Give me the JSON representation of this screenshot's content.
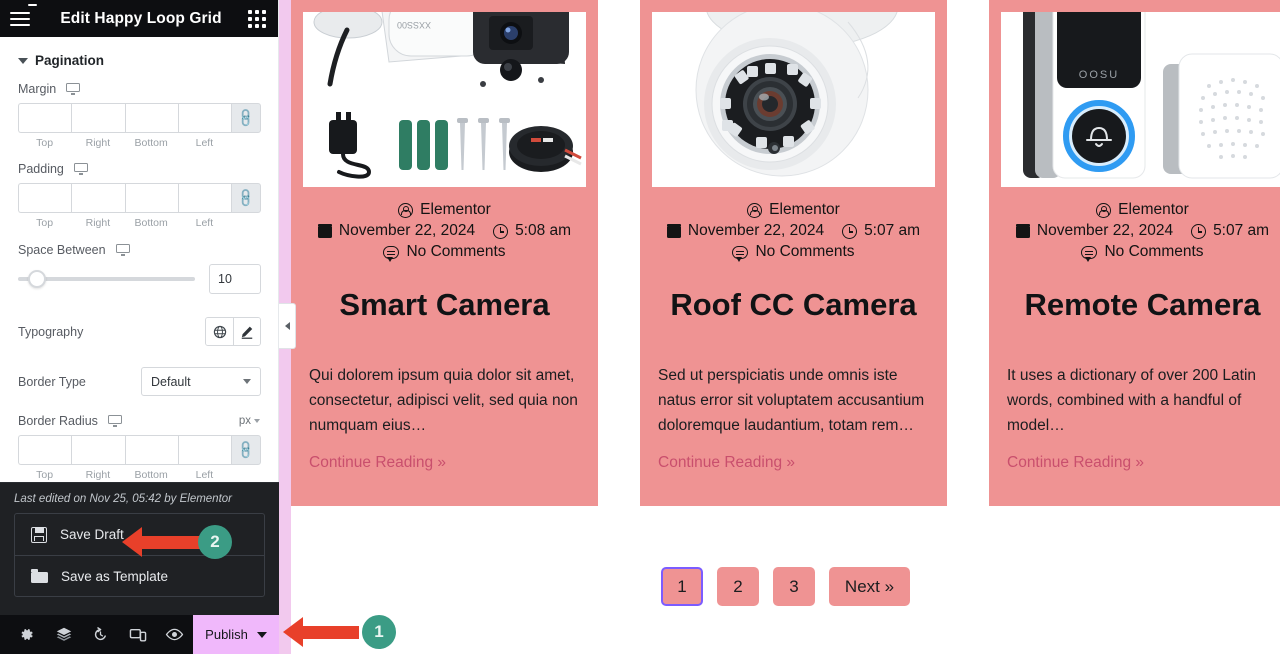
{
  "panel": {
    "title": "Edit Happy Loop Grid",
    "menu_icon": "hamburger-icon",
    "apps_icon": "apps-grid-icon",
    "section": {
      "title": "Pagination"
    },
    "controls": {
      "margin": {
        "label": "Margin",
        "device_icon": "desktop-icon",
        "link_icon": "link-icon",
        "values": [
          "",
          "",
          "",
          ""
        ],
        "sides": [
          "Top",
          "Right",
          "Bottom",
          "Left"
        ]
      },
      "padding": {
        "label": "Padding",
        "device_icon": "desktop-icon",
        "link_icon": "link-icon",
        "values": [
          "",
          "",
          "",
          ""
        ],
        "sides": [
          "Top",
          "Right",
          "Bottom",
          "Left"
        ]
      },
      "space_between": {
        "label": "Space Between",
        "device_icon": "desktop-icon",
        "value": "10"
      },
      "typography": {
        "label": "Typography",
        "global_icon": "globe-icon",
        "edit_icon": "pencil-icon"
      },
      "border_type": {
        "label": "Border Type",
        "value": "Default"
      },
      "border_radius": {
        "label": "Border Radius",
        "device_icon": "desktop-icon",
        "unit": "px",
        "link_icon": "link-icon",
        "values": [
          "",
          "",
          "",
          ""
        ],
        "sides": [
          "Top",
          "Right",
          "Bottom",
          "Left"
        ]
      }
    },
    "footer": {
      "last_edited": "Last edited on Nov 25, 05:42 by Elementor",
      "save_draft": {
        "label": "Save Draft",
        "icon": "floppy-disk-icon"
      },
      "save_as_template": {
        "label": "Save as Template",
        "icon": "folder-icon"
      }
    },
    "bottom_bar": {
      "icons": [
        "settings-gear-icon",
        "navigator-layers-icon",
        "history-clock-icon",
        "responsive-devices-icon",
        "preview-eye-icon"
      ],
      "publish": {
        "label": "Publish",
        "chevron_icon": "chevron-down-icon",
        "color": "#f0b8fb"
      }
    },
    "collapse_handle_icon": "chevron-left-icon"
  },
  "canvas": {
    "card_bg": "#ef9393",
    "link_color": "#c94f6d",
    "cards": [
      {
        "image_alt": "bullet-security-camera-with-accessories",
        "author": "Elementor",
        "date": "November 22, 2024",
        "time": "5:08 am",
        "comments": "No Comments",
        "title": "Smart Camera",
        "excerpt": "Qui dolorem ipsum quia dolor sit amet, consectetur, adipisci velit, sed quia non numquam eius…",
        "read_more": "Continue Reading »"
      },
      {
        "image_alt": "dome-security-camera",
        "author": "Elementor",
        "date": "November 22, 2024",
        "time": "5:07 am",
        "comments": "No Comments",
        "title": "Roof CC Camera",
        "excerpt": "Sed ut perspiciatis unde omnis iste natus error sit voluptatem accusantium doloremque laudantium, totam rem…",
        "read_more": "Continue Reading »"
      },
      {
        "image_alt": "video-doorbell-with-chime",
        "author": "Elementor",
        "date": "November 22, 2024",
        "time": "5:07 am",
        "comments": "No Comments",
        "title": "Remote Camera",
        "excerpt": "It uses a dictionary of over 200 Latin words, combined with a handful of model…",
        "read_more": "Continue Reading »"
      }
    ],
    "pagination": {
      "pages": [
        "1",
        "2",
        "3"
      ],
      "next_label": "Next »",
      "active_index": 0,
      "active_border": "#7c5cff"
    }
  },
  "annotations": {
    "marker_color": "#3b9c85",
    "arrow_color": "#e8402a",
    "items": [
      {
        "number": "1",
        "target": "publish-button"
      },
      {
        "number": "2",
        "target": "save-draft-item"
      }
    ]
  }
}
